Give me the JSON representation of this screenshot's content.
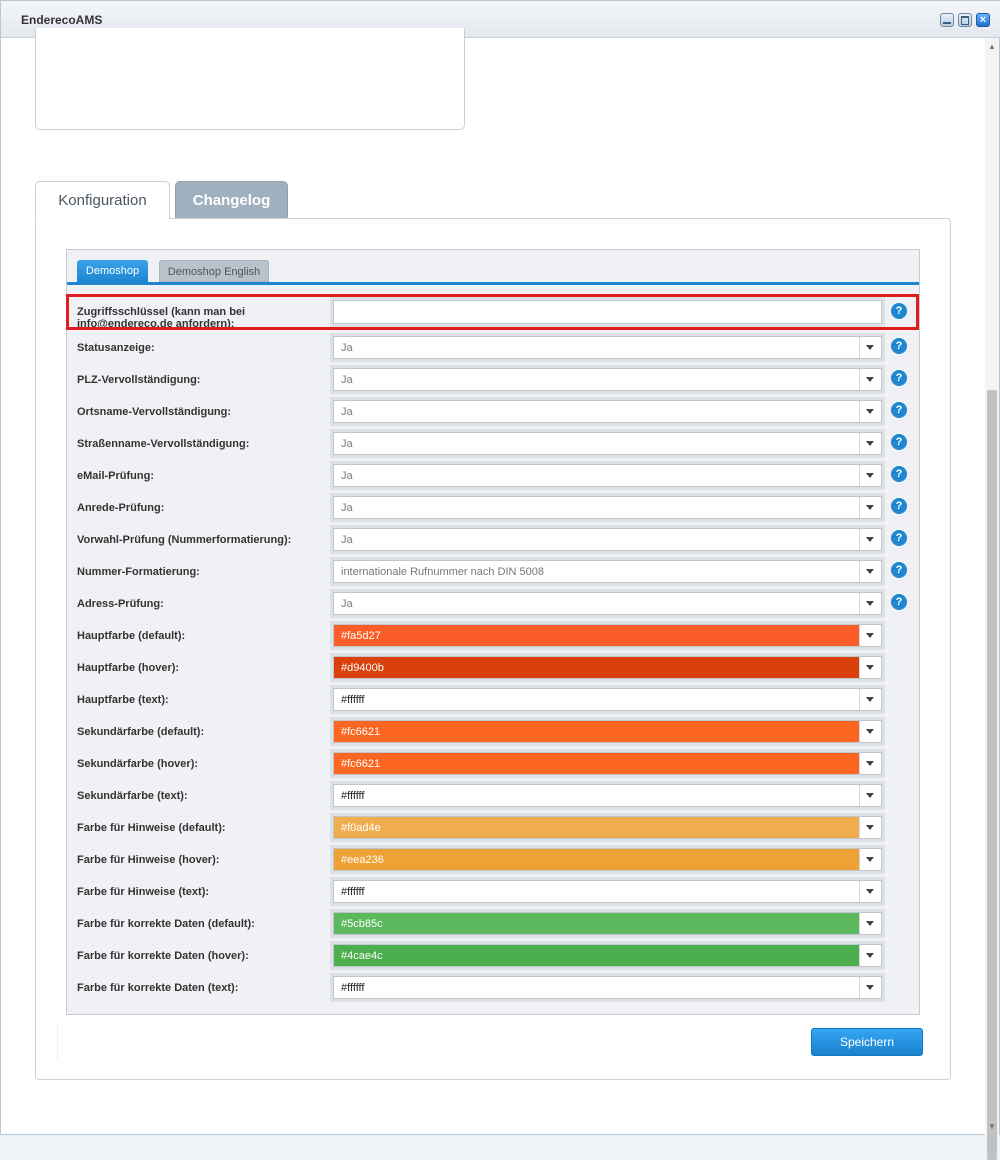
{
  "window": {
    "title": "EnderecoAMS",
    "controls": {
      "minimize": "minimize-icon",
      "maximize": "maximize-icon",
      "close": "×"
    }
  },
  "tabs": [
    {
      "label": "Konfiguration",
      "active": true
    },
    {
      "label": "Changelog",
      "active": false
    }
  ],
  "shop_tabs": [
    {
      "label": "Demoshop",
      "active": true
    },
    {
      "label": "Demoshop English",
      "active": false
    }
  ],
  "access_key": {
    "label_line1": "Zugriffsschlüssel (kann man bei",
    "label_line2": "info@endereco.de anfordern):",
    "value": "",
    "help": "?"
  },
  "settings": [
    {
      "label": "Statusanzeige:",
      "value": "Ja",
      "help": "?"
    },
    {
      "label": "PLZ-Vervollständigung:",
      "value": "Ja",
      "help": "?"
    },
    {
      "label": "Ortsname-Vervollständigung:",
      "value": "Ja",
      "help": "?"
    },
    {
      "label": "Straßenname-Vervollständigung:",
      "value": "Ja",
      "help": "?"
    },
    {
      "label": "eMail-Prüfung:",
      "value": "Ja",
      "help": "?"
    },
    {
      "label": "Anrede-Prüfung:",
      "value": "Ja",
      "help": "?"
    },
    {
      "label": "Vorwahl-Prüfung (Nummerformatierung):",
      "value": "Ja",
      "help": "?"
    },
    {
      "label": "Nummer-Formatierung:",
      "value": "internationale Rufnummer nach DIN 5008",
      "help": "?"
    },
    {
      "label": "Adress-Prüfung:",
      "value": "Ja",
      "help": "?"
    }
  ],
  "colors": [
    {
      "label": "Hauptfarbe (default):",
      "value": "#fa5d27",
      "bg": "#fa5d27"
    },
    {
      "label": "Hauptfarbe (hover):",
      "value": "#d9400b",
      "bg": "#d9400b"
    },
    {
      "label": "Hauptfarbe (text):",
      "value": "#ffffff",
      "bg": "#ffffff"
    },
    {
      "label": "Sekundärfarbe (default):",
      "value": "#fc6621",
      "bg": "#fc6621"
    },
    {
      "label": "Sekundärfarbe (hover):",
      "value": "#fc6621",
      "bg": "#fc6621"
    },
    {
      "label": "Sekundärfarbe (text):",
      "value": "#ffffff",
      "bg": "#ffffff"
    },
    {
      "label": "Farbe für Hinweise (default):",
      "value": "#f0ad4e",
      "bg": "#f0ad4e"
    },
    {
      "label": "Farbe für Hinweise (hover):",
      "value": "#eea236",
      "bg": "#eea236"
    },
    {
      "label": "Farbe für Hinweise (text):",
      "value": "#ffffff",
      "bg": "#ffffff"
    },
    {
      "label": "Farbe für korrekte Daten (default):",
      "value": "#5cb85c",
      "bg": "#5cb85c"
    },
    {
      "label": "Farbe für korrekte Daten (hover):",
      "value": "#4cae4c",
      "bg": "#4cae4c"
    },
    {
      "label": "Farbe für korrekte Daten (text):",
      "value": "#ffffff",
      "bg": "#ffffff"
    }
  ],
  "save_label": "Speichern",
  "accent_color": "#1f87d2",
  "highlight_color": "#e01d1d"
}
